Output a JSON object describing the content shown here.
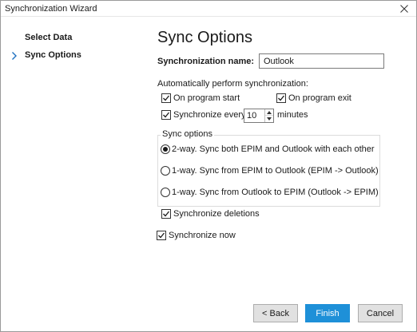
{
  "window": {
    "title": "Synchronization Wizard"
  },
  "sidebar": {
    "items": [
      {
        "label": "Select Data",
        "active": false
      },
      {
        "label": "Sync Options",
        "active": true
      }
    ]
  },
  "content": {
    "heading": "Sync Options",
    "sync_name": {
      "label": "Synchronization name:",
      "value": "Outlook"
    },
    "auto_label": "Automatically perform synchronization:",
    "on_start": {
      "label": "On program start",
      "checked": true
    },
    "on_exit": {
      "label": "On program exit",
      "checked": true
    },
    "sync_every": {
      "label": "Synchronize every",
      "checked": true,
      "value": "10",
      "unit": "minutes"
    },
    "sync_options": {
      "legend": "Sync options",
      "options": [
        {
          "label": "2-way. Sync both EPIM and Outlook with each other",
          "selected": true
        },
        {
          "label": "1-way. Sync from EPIM to Outlook (EPIM -> Outlook)",
          "selected": false
        },
        {
          "label": "1-way. Sync from Outlook to EPIM (Outlook -> EPIM)",
          "selected": false
        }
      ]
    },
    "sync_deletions": {
      "label": "Synchronize deletions",
      "checked": true
    },
    "sync_now": {
      "label": "Synchronize now",
      "checked": true
    }
  },
  "buttons": {
    "back": "< Back",
    "finish": "Finish",
    "cancel": "Cancel"
  },
  "colors": {
    "accent": "#1e90d8",
    "chevron": "#1e70c0"
  },
  "icons": {
    "close": "close-icon",
    "chevron": "chevron-right-icon",
    "check": "checkmark-icon"
  }
}
